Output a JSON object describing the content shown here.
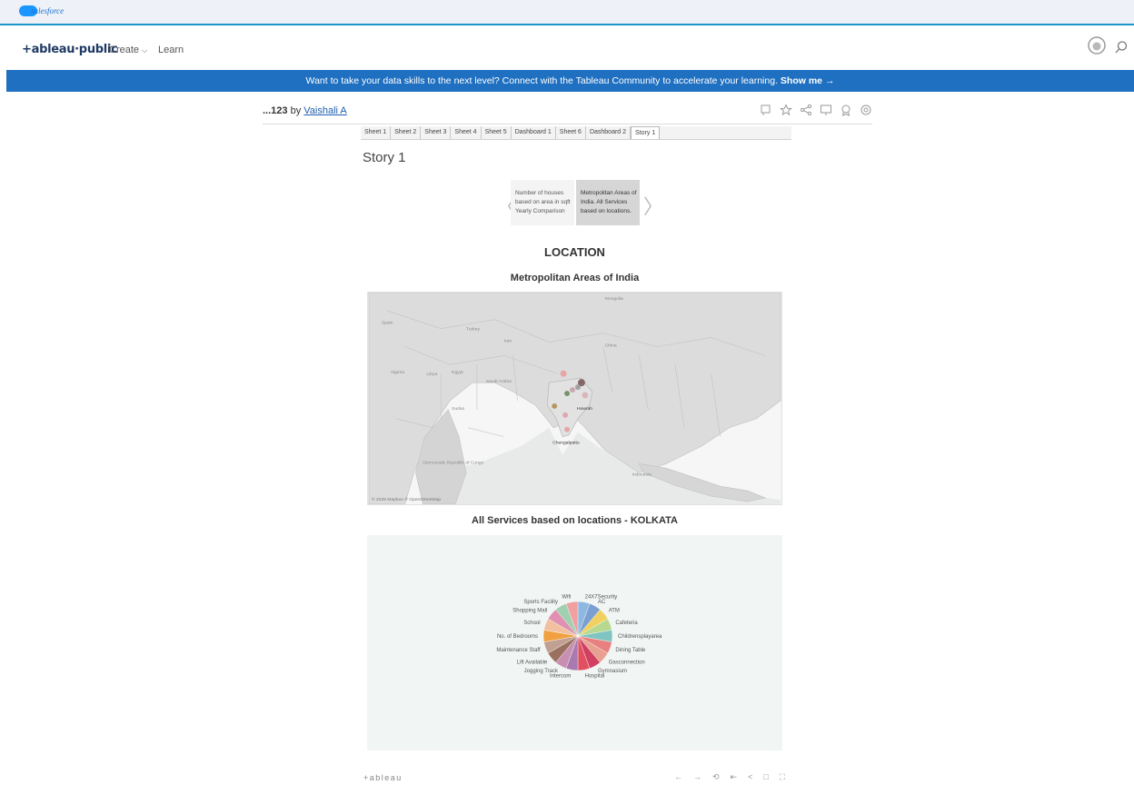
{
  "salesforce": {
    "label": "salesforce"
  },
  "header": {
    "logo": "+ableau·public",
    "nav": {
      "create": "Create",
      "learn": "Learn"
    },
    "icons": [
      "avatar-icon",
      "search-icon"
    ]
  },
  "banner": {
    "text": "Want to take your data skills to the next level? Connect with the Tableau Community to accelerate your learning.",
    "link": "Show me",
    "link_arrow": "→"
  },
  "viz": {
    "title_prefix": "...123",
    "by": "by",
    "author": "Vaishali A"
  },
  "toolbar_icons": [
    "comment-icon",
    "favorite-icon",
    "share-icon",
    "download-icon",
    "badge-icon",
    "settings-icon"
  ],
  "tabs": [
    {
      "label": "Sheet 1"
    },
    {
      "label": "Sheet 2"
    },
    {
      "label": "Sheet 3"
    },
    {
      "label": "Sheet 4"
    },
    {
      "label": "Sheet 5"
    },
    {
      "label": "Dashboard 1"
    },
    {
      "label": "Sheet 6"
    },
    {
      "label": "Dashboard 2"
    },
    {
      "label": "Story 1",
      "active": true
    }
  ],
  "story": {
    "title": "Story 1",
    "points": [
      {
        "text": "Number of houses based on area in sqft Yearly Comparison"
      },
      {
        "text": "Metropolitan Areas of India. All Services based on locations."
      }
    ],
    "section_title": "LOCATION"
  },
  "map": {
    "title": "Metropolitan Areas of India",
    "attribution": "© 2025 Mapbox © OpenStreetMap",
    "labels": [
      "Spain",
      "Turkey",
      "Iran",
      "China",
      "Algeria",
      "Libya",
      "Egypt",
      "Saudi Arabia",
      "Sudan",
      "Democratic Republic of Congo",
      "Indonesia",
      "Mongolia"
    ],
    "city_labels": [
      "Howrah",
      "Chengalpattu"
    ],
    "dot_colors": [
      "#e8a0a0",
      "#7a5a5a",
      "#9a9a9a",
      "#c8a0a8",
      "#d8b0b8",
      "#6a8a5a",
      "#b09050",
      "#e0a0a8"
    ]
  },
  "chart_data": {
    "type": "pie",
    "title": "All Services based on locations - KOLKATA",
    "categories": [
      "24X7Security",
      "AC",
      "ATM",
      "Cafeteria",
      "Childrensplayarea",
      "Dining Table",
      "Gasconnection",
      "Gymnasium",
      "Hospital",
      "Intercom",
      "Jogging Track",
      "Lift Available",
      "Maintenance Staff",
      "No. of Bedrooms",
      "School",
      "Shopping Mall",
      "Sports Facility",
      "Wifi"
    ],
    "values": [
      1,
      1,
      1,
      1,
      1,
      1,
      1,
      1,
      1,
      1,
      1,
      1,
      1,
      1,
      1,
      1,
      1,
      1
    ],
    "colors": [
      "#8fb8e0",
      "#7a9fd0",
      "#f0d060",
      "#b8d890",
      "#7fc4c0",
      "#e88080",
      "#e8a090",
      "#d04060",
      "#e05060",
      "#a87ab0",
      "#c890b0",
      "#9a7060",
      "#c0a090",
      "#f0a040",
      "#f0c0a0",
      "#e090b0",
      "#a0d0b0",
      "#f0a0a0"
    ]
  },
  "footer": {
    "logo": "+ableau",
    "icons": [
      "undo-icon",
      "redo-icon",
      "revert-icon",
      "reset-icon",
      "share-icon",
      "comment-icon",
      "fullscreen-icon"
    ]
  }
}
